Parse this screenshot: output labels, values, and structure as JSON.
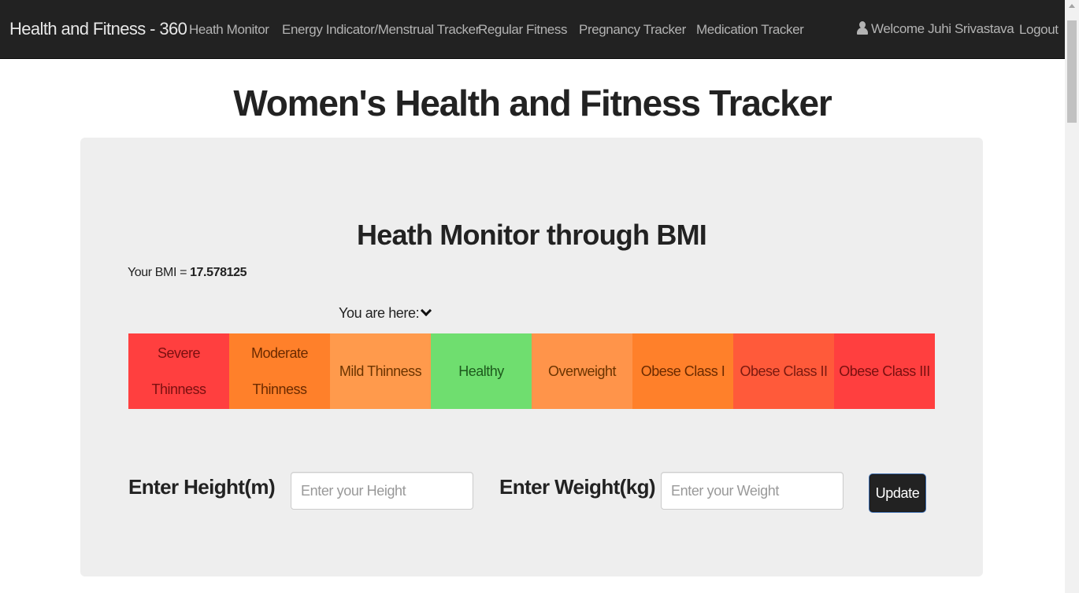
{
  "navbar": {
    "brand": "Health and Fitness - 360",
    "items": [
      {
        "label": "Heath Monitor"
      },
      {
        "label": "Energy Indicator/Menstrual Tracker"
      },
      {
        "label": "Regular Fitness"
      },
      {
        "label": "Pregnancy Tracker"
      },
      {
        "label": "Medication Tracker"
      }
    ],
    "welcome": "Welcome Juhi Srivastava",
    "logout": "Logout"
  },
  "page": {
    "title": "Women's Health and Fitness Tracker"
  },
  "panel": {
    "title": "Heath Monitor through BMI",
    "bmi_prefix": "Your BMI = ",
    "bmi_value": "17.578125",
    "here_label": "You are here:",
    "categories": [
      {
        "label": "Severe Thinness",
        "color": "#ff3f3f",
        "text_color": "#7a1010"
      },
      {
        "label": "Moderate Thinness",
        "color": "#ff802a",
        "text_color": "#6b2a00"
      },
      {
        "label": "Mild Thinness",
        "color": "#ff9a4c",
        "text_color": "#6b3400"
      },
      {
        "label": "Healthy",
        "color": "#6fde6f",
        "text_color": "#1d5a1d"
      },
      {
        "label": "Overweight",
        "color": "#ff944a",
        "text_color": "#6b3400"
      },
      {
        "label": "Obese Class I",
        "color": "#ff802a",
        "text_color": "#6b2a00"
      },
      {
        "label": "Obese Class II",
        "color": "#ff5a3a",
        "text_color": "#7a1a10"
      },
      {
        "label": "Obese Class III",
        "color": "#ff3f3f",
        "text_color": "#7a1010"
      }
    ],
    "height_label": "Enter Height(m)",
    "height_placeholder": "Enter your Height",
    "weight_label": "Enter Weight(kg)",
    "weight_placeholder": "Enter your Weight",
    "update_label": "Update"
  }
}
